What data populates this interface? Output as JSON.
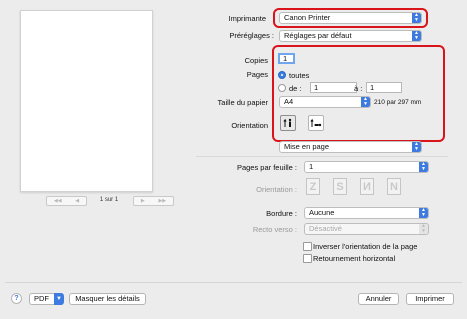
{
  "preview": {
    "page_indicator": "1 sur 1"
  },
  "printer": {
    "label": "Imprimante",
    "value": "Canon Printer"
  },
  "presets": {
    "label": "Préréglages :",
    "value": "Réglages par défaut"
  },
  "copies": {
    "label": "Copies",
    "value": "1"
  },
  "pages": {
    "label": "Pages",
    "all_label": "toutes",
    "from_label": "de :",
    "from_value": "1",
    "to_label": "à :",
    "to_value": "1"
  },
  "paper_size": {
    "label": "Taille du papier",
    "value": "A4",
    "dimensions": "210 par 297 mm"
  },
  "orientation": {
    "label": "Orientation"
  },
  "section_menu": {
    "value": "Mise en page"
  },
  "pages_per_sheet": {
    "label": "Pages par feuille :",
    "value": "1"
  },
  "layout_direction": {
    "label": "Orientation :"
  },
  "border": {
    "label": "Bordure :",
    "value": "Aucune"
  },
  "two_sided": {
    "label": "Recto verso :",
    "value": "Désactivé"
  },
  "reverse_orientation": {
    "label": "Inverser l'orientation de la page"
  },
  "flip_horizontal": {
    "label": "Retournement horizontal"
  },
  "footer": {
    "help": "?",
    "pdf": "PDF",
    "hide_details": "Masquer les détails",
    "cancel": "Annuler",
    "print": "Imprimer"
  }
}
